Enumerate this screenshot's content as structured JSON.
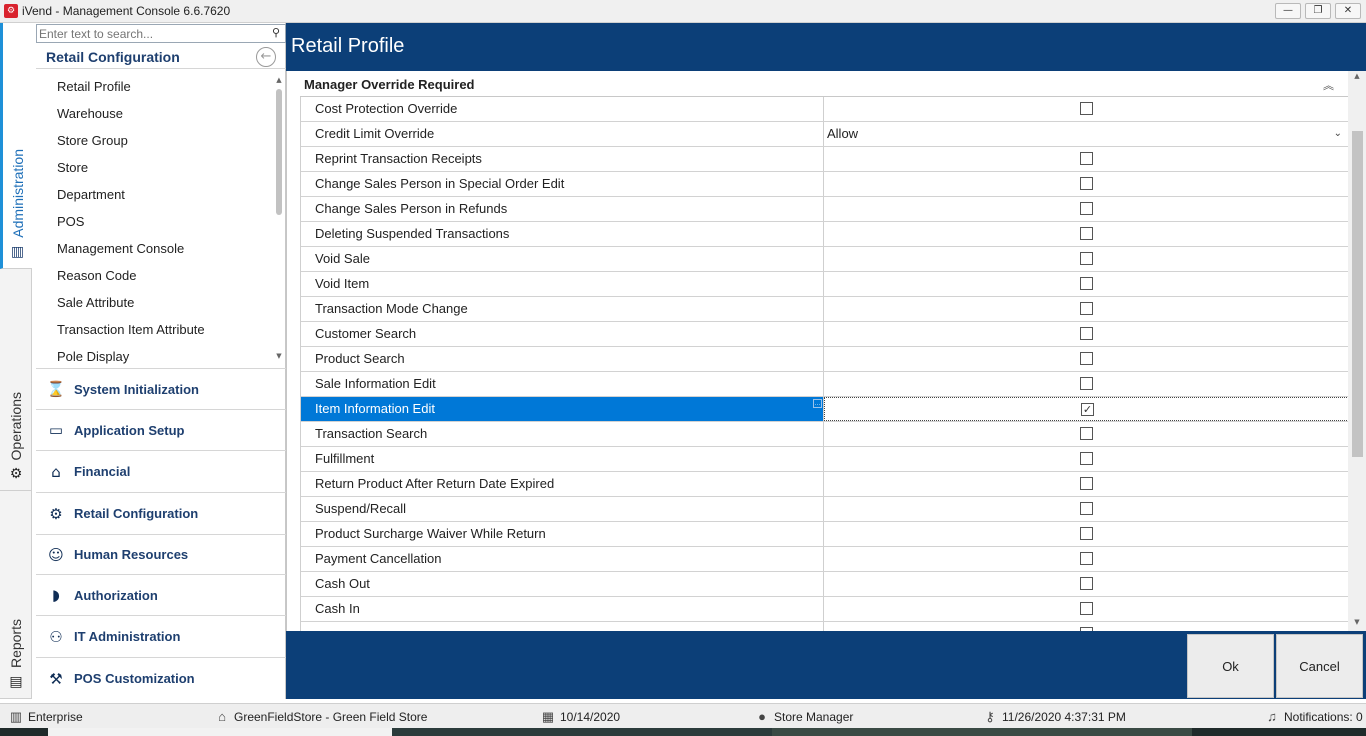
{
  "window": {
    "title": "iVend - Management Console  6.6.7620",
    "minimize": "—",
    "restore": "❐",
    "close": "✕"
  },
  "vtabs": [
    {
      "label": "Administration",
      "icon": "building-icon",
      "active": true
    },
    {
      "label": "Operations",
      "icon": "gear-icon",
      "active": false
    },
    {
      "label": "Reports",
      "icon": "report-icon",
      "active": false
    }
  ],
  "nav": {
    "search_placeholder": "Enter text to search...",
    "section_title": "Retail Configuration",
    "items": [
      "Retail Profile",
      "Warehouse",
      "Store Group",
      "Store",
      "Department",
      "POS",
      "Management Console",
      "Reason Code",
      "Sale Attribute",
      "Transaction Item Attribute",
      "Pole Display"
    ],
    "modules": [
      {
        "label": "System Initialization",
        "icon": "hourglass-icon"
      },
      {
        "label": "Application Setup",
        "icon": "terminal-icon"
      },
      {
        "label": "Financial",
        "icon": "bank-icon"
      },
      {
        "label": "Retail Configuration",
        "icon": "gears-icon"
      },
      {
        "label": "Human Resources",
        "icon": "people-icon"
      },
      {
        "label": "Authorization",
        "icon": "shield-icon"
      },
      {
        "label": "IT Administration",
        "icon": "it-admin-icon"
      },
      {
        "label": "POS Customization",
        "icon": "pos-custom-icon"
      }
    ]
  },
  "page": {
    "title": "Retail Profile",
    "group_title": "Manager Override Required"
  },
  "grid": {
    "rows": [
      {
        "name": "Cost Protection Override",
        "type": "checkbox",
        "checked": false
      },
      {
        "name": "Credit Limit Override",
        "type": "dropdown",
        "value": "Allow"
      },
      {
        "name": "Reprint Transaction Receipts",
        "type": "checkbox",
        "checked": false
      },
      {
        "name": "Change Sales Person in Special Order Edit",
        "type": "checkbox",
        "checked": false
      },
      {
        "name": "Change Sales Person in Refunds",
        "type": "checkbox",
        "checked": false
      },
      {
        "name": "Deleting Suspended Transactions",
        "type": "checkbox",
        "checked": false
      },
      {
        "name": "Void Sale",
        "type": "checkbox",
        "checked": false
      },
      {
        "name": "Void Item",
        "type": "checkbox",
        "checked": false
      },
      {
        "name": "Transaction Mode Change",
        "type": "checkbox",
        "checked": false
      },
      {
        "name": "Customer Search",
        "type": "checkbox",
        "checked": false
      },
      {
        "name": "Product Search",
        "type": "checkbox",
        "checked": false
      },
      {
        "name": "Sale Information Edit",
        "type": "checkbox",
        "checked": false
      },
      {
        "name": "Item Information Edit",
        "type": "checkbox",
        "checked": true,
        "selected": true
      },
      {
        "name": "Transaction Search",
        "type": "checkbox",
        "checked": false
      },
      {
        "name": "Fulfillment",
        "type": "checkbox",
        "checked": false
      },
      {
        "name": "Return Product After Return Date Expired",
        "type": "checkbox",
        "checked": false
      },
      {
        "name": "Suspend/Recall",
        "type": "checkbox",
        "checked": false
      },
      {
        "name": "Product Surcharge Waiver While Return",
        "type": "checkbox",
        "checked": false
      },
      {
        "name": "Payment Cancellation",
        "type": "checkbox",
        "checked": false
      },
      {
        "name": "Cash Out",
        "type": "checkbox",
        "checked": false
      },
      {
        "name": "Cash In",
        "type": "checkbox",
        "checked": false
      },
      {
        "name": "",
        "type": "checkbox",
        "checked": false
      }
    ]
  },
  "footer": {
    "ok_label": "Ok",
    "cancel_label": "Cancel"
  },
  "status": {
    "edition": "Enterprise",
    "store": "GreenFieldStore - Green Field Store",
    "date": "10/14/2020",
    "user": "Store Manager",
    "login_time": "11/26/2020 4:37:31 PM",
    "notifications": "Notifications: 0"
  },
  "colors": {
    "header_blue": "#0c3f78",
    "selection_blue": "#0078d7",
    "nav_text": "#1e3f6f"
  }
}
